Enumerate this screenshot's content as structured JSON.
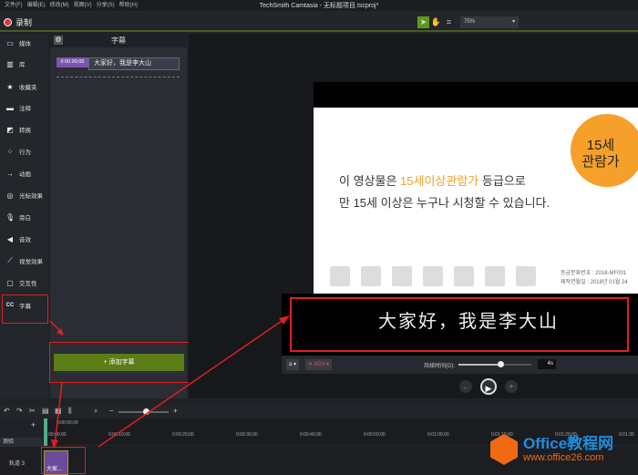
{
  "menu": [
    "文件(F)",
    "编辑(E)",
    "修改(M)",
    "视图(V)",
    "分享(S)",
    "帮助(H)"
  ],
  "window_title": "TechSmith Camtasia - 无标题项目.tscproj*",
  "record_label": "录制",
  "zoom_level": "75%",
  "sidebar": [
    {
      "icon": "film-icon",
      "label": "媒体"
    },
    {
      "icon": "library-icon",
      "label": "库"
    },
    {
      "icon": "star-icon",
      "label": "收藏夹"
    },
    {
      "icon": "annotation-icon",
      "label": "注释"
    },
    {
      "icon": "transition-icon",
      "label": "转换"
    },
    {
      "icon": "behavior-icon",
      "label": "行为"
    },
    {
      "icon": "animation-icon",
      "label": "动画"
    },
    {
      "icon": "cursor-icon",
      "label": "光标效果"
    },
    {
      "icon": "mic-icon",
      "label": "旁白"
    },
    {
      "icon": "audio-icon",
      "label": "音效"
    },
    {
      "icon": "wand-icon",
      "label": "视觉效果"
    },
    {
      "icon": "interactive-icon",
      "label": "交互性"
    },
    {
      "icon": "cc-icon",
      "label": "字幕"
    }
  ],
  "panel": {
    "title": "字幕",
    "caption_time": "0:00:00;00",
    "caption_text": "大家好，我是李大山",
    "add_button": "+ 添加字幕"
  },
  "video": {
    "line1_pre": "이 영상물은 ",
    "line1_highlight": "15세이상관람가",
    "line1_post": " 등급으로",
    "line2": "만 15세 이상은 누구나 시청할 수 있습니다.",
    "badge_line1": "15세",
    "badge_line2": "관람가",
    "rating1": "등급분류번호 : 2018-MF001",
    "rating2": "제작연월일 : 2018년 01월 24"
  },
  "editor": {
    "text": "大家好，我是李大山",
    "font_btn": "a",
    "ada_btn": "ADA",
    "duration_label": "持续时间(D):",
    "duration_value": "4s",
    "duration_fraction": 0.58
  },
  "timeline": {
    "playhead": "0:00:00;00",
    "ticks": [
      "0:00:00;00",
      "0:00:10;00",
      "0:00:20;00",
      "0:00:30;00",
      "0:00:40;00",
      "0:00:50;00",
      "0:01:00;00",
      "0:01:10;00",
      "0:01:20;00",
      "0:01:30"
    ],
    "track_header": "测验",
    "track_label": "轨道 3",
    "clip_label": "大家..."
  },
  "watermark": {
    "name": "Office教程网",
    "url": "www.office26.com"
  }
}
